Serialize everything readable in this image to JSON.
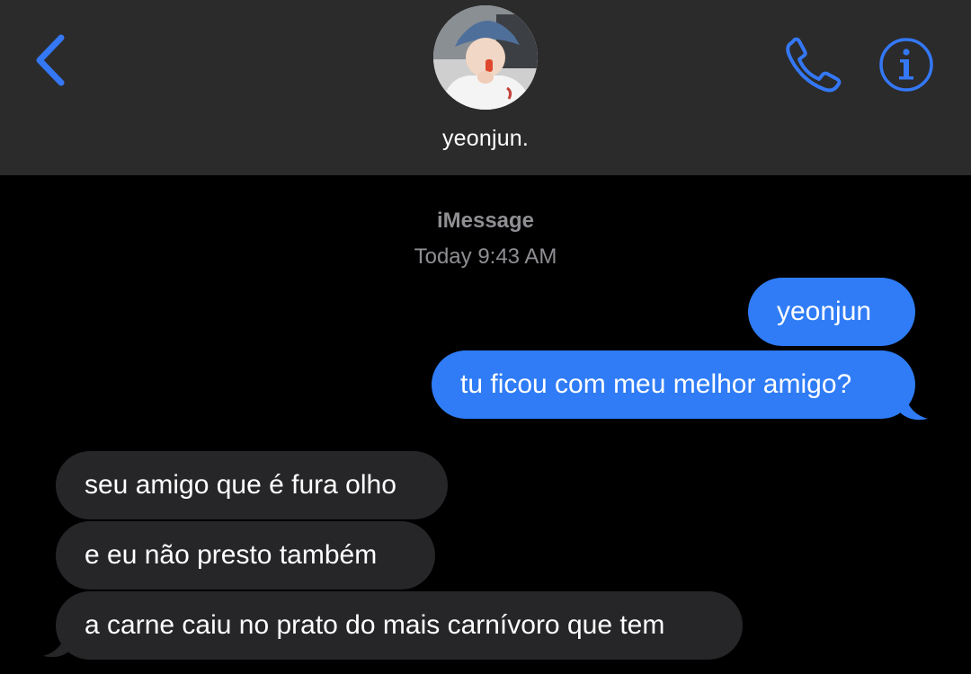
{
  "header": {
    "contact_name": "yeonjun."
  },
  "thread": {
    "service": "iMessage",
    "timestamp": "Today 9:43 AM"
  },
  "messages": [
    {
      "direction": "sent",
      "text": "yeonjun"
    },
    {
      "direction": "sent",
      "text": "tu ficou com meu melhor amigo?"
    },
    {
      "direction": "received",
      "text": "seu amigo que é fura olho"
    },
    {
      "direction": "received",
      "text": "e eu não presto também"
    },
    {
      "direction": "received",
      "text": "a carne caiu no prato do mais carnívoro que tem"
    }
  ],
  "colors": {
    "accent": "#3478f6",
    "sent_bubble": "#2f7cf6",
    "received_bubble": "#262628",
    "header_bg": "#2b2b2b",
    "meta_text": "#8e8e93"
  },
  "icons": {
    "back": "chevron-left-icon",
    "call": "phone-icon",
    "info": "info-icon"
  }
}
